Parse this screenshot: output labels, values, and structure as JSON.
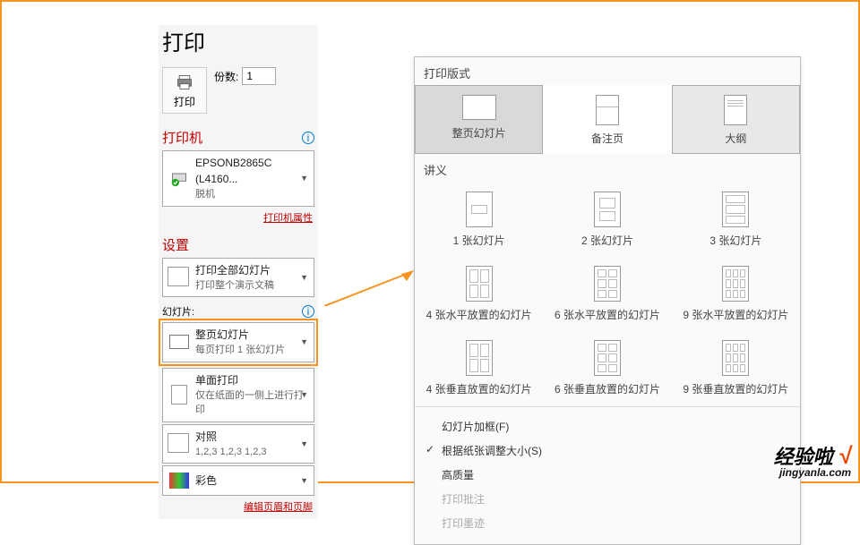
{
  "title": "打印",
  "copies_label": "份数:",
  "copies_value": "1",
  "print_btn": "打印",
  "printer_head": "打印机",
  "printer_name": "EPSONB2865C (L4160...",
  "printer_status": "脱机",
  "printer_props": "打印机属性",
  "settings_head": "设置",
  "print_all": {
    "line1": "打印全部幻灯片",
    "line2": "打印整个演示文稿"
  },
  "slides_label": "幻灯片:",
  "full_slide": {
    "line1": "整页幻灯片",
    "line2": "每页打印 1 张幻灯片"
  },
  "single_side": {
    "line1": "单面打印",
    "line2": "仅在纸面的一侧上进行打印"
  },
  "collate": {
    "line1": "对照",
    "line2": "1,2,3   1,2,3   1,2,3"
  },
  "color": "彩色",
  "footer_link": "编辑页眉和页脚",
  "popup": {
    "layout_head": "打印版式",
    "tabs": [
      "整页幻灯片",
      "备注页",
      "大纲"
    ],
    "handout_head": "讲义",
    "handouts_r1": [
      "1 张幻灯片",
      "2 张幻灯片",
      "3 张幻灯片"
    ],
    "handouts_r2": [
      "4 张水平放置的幻灯片",
      "6 张水平放置的幻灯片",
      "9 张水平放置的幻灯片"
    ],
    "handouts_r3": [
      "4 张垂直放置的幻灯片",
      "6 张垂直放置的幻灯片",
      "9 张垂直放置的幻灯片"
    ],
    "menu": {
      "frame": "幻灯片加框(F)",
      "scale": "根据纸张调整大小(S)",
      "hq": "高质量",
      "comments": "打印批注",
      "ink": "打印墨迹"
    }
  },
  "watermark": {
    "l1a": "经验啦",
    "l1b": "√",
    "l2": "jingyanla.com"
  }
}
